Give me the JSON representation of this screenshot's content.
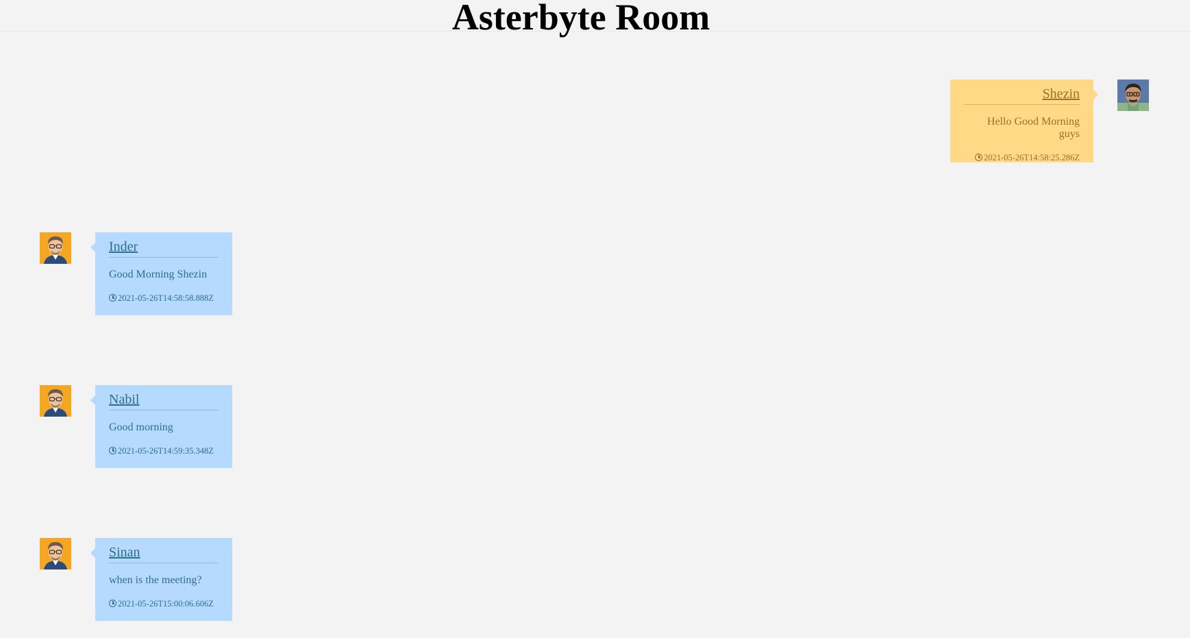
{
  "room": {
    "title": "Asterbyte Room"
  },
  "colors": {
    "incoming_bubble": "#b6daff",
    "outgoing_bubble": "#ffd986",
    "incoming_text": "#2f6f86",
    "outgoing_text": "#9a7128",
    "background": "#f3f3f3"
  },
  "messages": [
    {
      "sender": "Shezin",
      "text": "Hello Good Morning guys",
      "timestamp": "2021-05-26T14:58:25.286Z",
      "direction": "outgoing",
      "avatar_icon": "cartoon-man-avatar-icon",
      "clock_icon": "clock-icon"
    },
    {
      "sender": "Inder",
      "text": "Good Morning Shezin",
      "timestamp": "2021-05-26T14:58:58.888Z",
      "direction": "incoming",
      "avatar_icon": "man-with-glasses-avatar-icon",
      "clock_icon": "clock-icon"
    },
    {
      "sender": "Nabil",
      "text": "Good morning",
      "timestamp": "2021-05-26T14:59:35.348Z",
      "direction": "incoming",
      "avatar_icon": "man-with-glasses-avatar-icon",
      "clock_icon": "clock-icon"
    },
    {
      "sender": "Sinan",
      "text": "when is the meeting?",
      "timestamp": "2021-05-26T15:00:06.606Z",
      "direction": "incoming",
      "avatar_icon": "man-with-glasses-avatar-icon",
      "clock_icon": "clock-icon"
    }
  ]
}
